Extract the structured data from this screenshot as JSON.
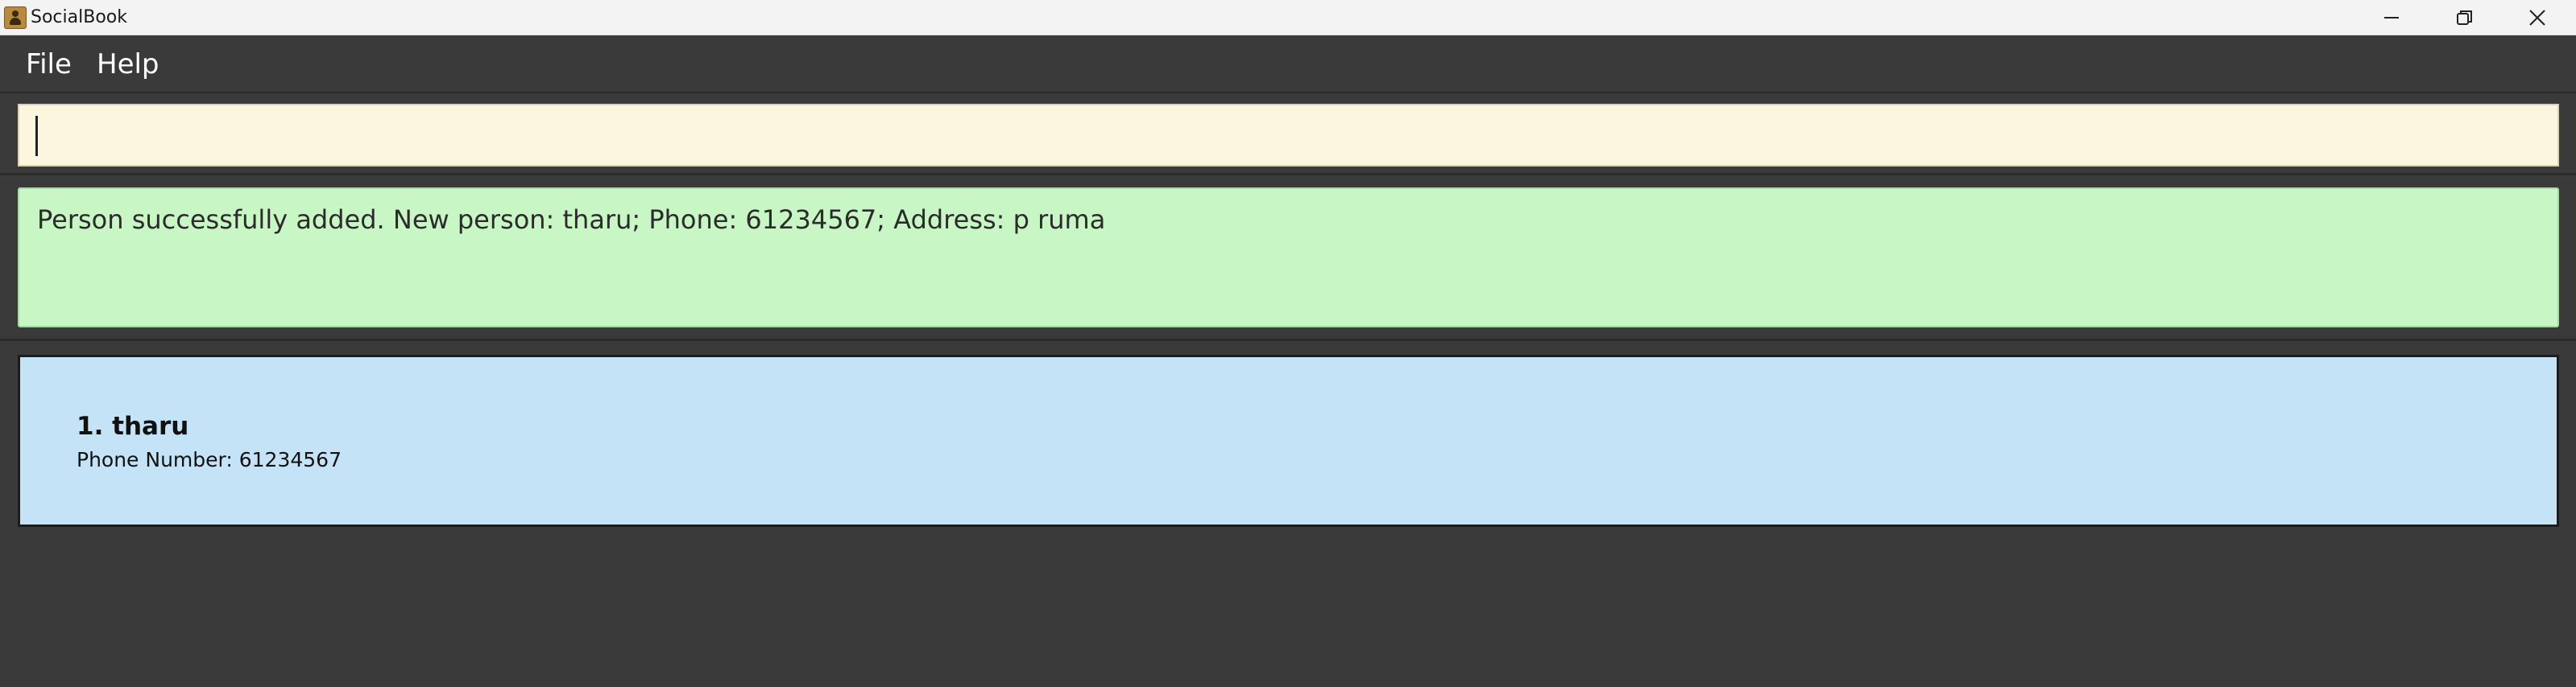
{
  "window": {
    "title": "SocialBook",
    "controls": [
      "minimize-icon",
      "restore-icon",
      "close-icon"
    ]
  },
  "menu": {
    "items": [
      {
        "label": "File"
      },
      {
        "label": "Help"
      }
    ]
  },
  "command_box": {
    "value": "",
    "placeholder": ""
  },
  "result_display": {
    "text": "Person successfully added. New person: tharu; Phone: 61234567; Address: p ruma"
  },
  "person_list": [
    {
      "index_name": "1. tharu",
      "phone_line": "Phone Number: 61234567"
    }
  ],
  "colors": {
    "background": "#3a3a3a",
    "command_box_bg": "#fdf6de",
    "result_bg": "#c8f7c5",
    "card_bg": "#c5e3f7"
  }
}
